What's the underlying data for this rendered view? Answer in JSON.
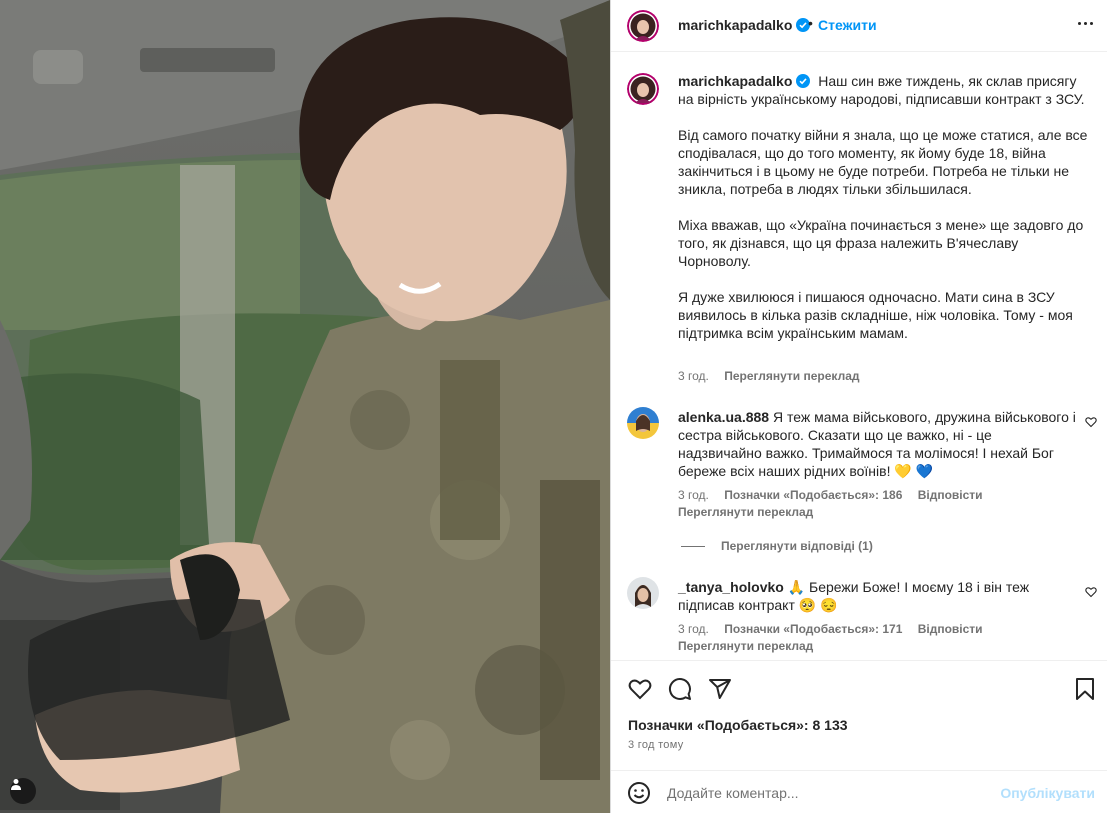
{
  "post": {
    "username": "marichkapadalko",
    "follow_label": "Стежити",
    "dot": "•",
    "caption_paragraphs": [
      "Наш син вже тиждень, як склав присягу на вірність українському народові, підписавши контракт з ЗСУ.",
      "Від самого початку війни я знала, що це може статися, але все сподівалася, що до того моменту, як йому буде 18, війна закінчиться і в цьому не буде потреби. Потреба не тільки не зникла, потреба в людях тільки збільшилася.",
      "Міха вважав, що «Україна починається з мене» ще задовго до того, як дізнався, що ця фраза належить В'ячеславу Чорноволу.",
      "Я дуже хвилююся і пишаюся одночасно. Мати сина в ЗСУ виявилось в кілька разів складніше, ніж чоловіка. Тому - моя підтримка всім українським мамам."
    ],
    "caption_time": "3 год.",
    "translate_label": "Переглянути переклад"
  },
  "comments": [
    {
      "username": "alenka.ua.888",
      "text": "Я теж мама військового, дружина військового і сестра військового. Сказати що це важко, ні - це надзвичайно важко. Тримаймося та молімося! І нехай Бог береже всіх наших рідних воїнів! 💛 💙",
      "time": "3 год.",
      "likes": "Позначки «Подобається»: 186",
      "reply": "Відповісти",
      "translate": "Переглянути переклад",
      "view_replies": "Переглянути відповіді (1)"
    },
    {
      "username": "_tanya_holovko",
      "text": "🙏 Бережи Боже! І моєму 18 і він теж підписав контракт 🥺 😔",
      "time": "3 год.",
      "likes": "Позначки «Подобається»: 171",
      "reply": "Відповісти",
      "translate": "Переглянути переклад"
    }
  ],
  "footer": {
    "likes": "Позначки «Подобається»: 8 133",
    "time": "3 год тому",
    "comment_placeholder": "Додайте коментар...",
    "publish_label": "Опублікувати"
  },
  "colors": {
    "accent": "#0095f6",
    "verified": "#0095f6",
    "muted": "#737373",
    "publish_disabled": "#b2dffc"
  },
  "icons": [
    "verified-icon",
    "more-icon",
    "heart-icon",
    "comment-icon",
    "share-icon",
    "bookmark-icon",
    "emoji-icon",
    "user-tag-icon"
  ]
}
